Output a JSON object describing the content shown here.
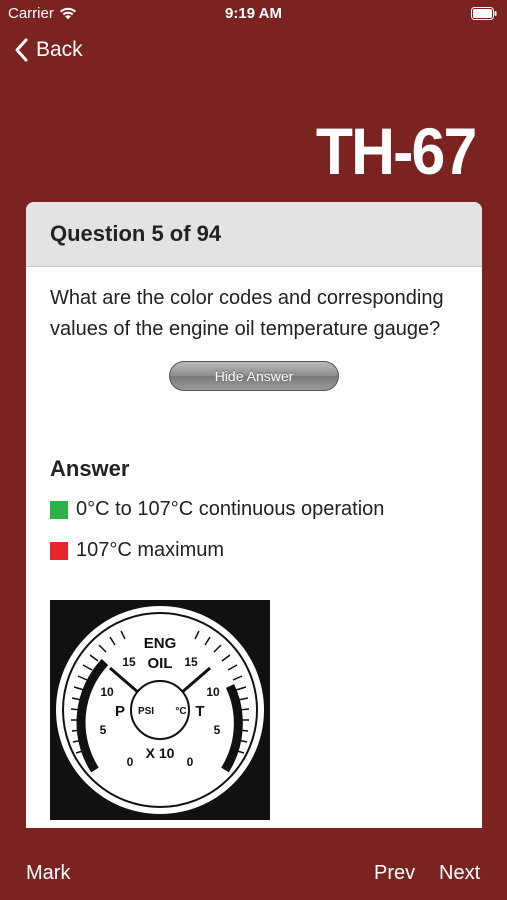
{
  "status_bar": {
    "carrier": "Carrier",
    "time": "9:19 AM"
  },
  "nav": {
    "back_label": "Back",
    "logo_text": "TH-67"
  },
  "card": {
    "header": "Question 5 of 94",
    "question": "What are the color codes and corresponding values of the engine oil temperature gauge?",
    "hide_answer_label": "Hide Answer",
    "answer_heading": "Answer",
    "answers": [
      {
        "color": "#2bb34a",
        "text": "0°C to 107°C continuous operation"
      },
      {
        "color": "#e8262b",
        "text": "107°C maximum"
      }
    ],
    "gauge": {
      "title_line1": "ENG",
      "title_line2": "OIL",
      "left_letter": "P",
      "right_letter": "T",
      "left_unit": "PSI",
      "right_unit": "°C",
      "multiplier": "X 10",
      "left_scale": [
        "0",
        "5",
        "10",
        "15"
      ],
      "right_scale": [
        "0",
        "5",
        "10",
        "15"
      ]
    }
  },
  "toolbar": {
    "mark_label": "Mark",
    "prev_label": "Prev",
    "next_label": "Next"
  },
  "colors": {
    "background": "#7a2320",
    "card_header": "#e3e3e3",
    "green": "#2bb34a",
    "red": "#e8262b"
  }
}
